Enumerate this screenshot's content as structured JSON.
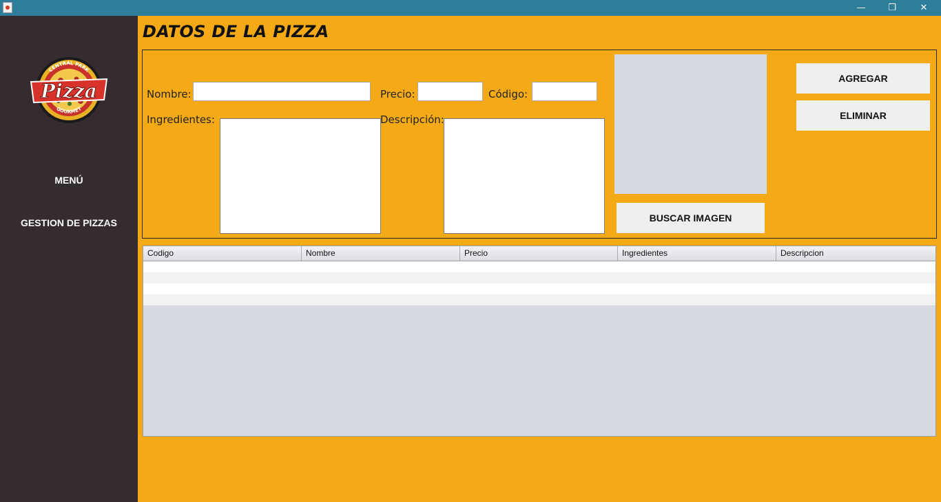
{
  "window": {
    "minimize_glyph": "—",
    "restore_glyph": "❐",
    "close_glyph": "✕"
  },
  "sidebar": {
    "logo": {
      "top_text": "CENTRAL PARK",
      "main_text": "Pizza",
      "bottom_text": "GOURMET"
    },
    "items": [
      {
        "label": "MENÚ"
      },
      {
        "label": "GESTION DE PIZZAS"
      }
    ]
  },
  "main": {
    "title": "DATOS DE LA PIZZA",
    "form": {
      "nombre_label": "Nombre:",
      "nombre_value": "",
      "precio_label": "Precio:",
      "precio_value": "",
      "codigo_label": "Código:",
      "codigo_value": "",
      "ingredientes_label": "Ingredientes:",
      "ingredientes_value": "",
      "descripcion_label": "Descripción:",
      "descripcion_value": ""
    },
    "buttons": {
      "agregar": "AGREGAR",
      "eliminar": "ELIMINAR",
      "buscar_imagen": "BUSCAR IMAGEN"
    },
    "table": {
      "columns": [
        "Codigo",
        "Nombre",
        "Precio",
        "Ingredientes",
        "Descripcion"
      ],
      "rows": [
        [
          "",
          "",
          "",
          "",
          ""
        ],
        [
          "",
          "",
          "",
          "",
          ""
        ],
        [
          "",
          "",
          "",
          "",
          ""
        ],
        [
          "",
          "",
          "",
          "",
          ""
        ]
      ]
    }
  },
  "colors": {
    "titlebar": "#2e7d9b",
    "sidebar": "#352c2f",
    "main_background": "#f4aa16",
    "image_placeholder": "#d7dae2",
    "button": "#efefef"
  }
}
